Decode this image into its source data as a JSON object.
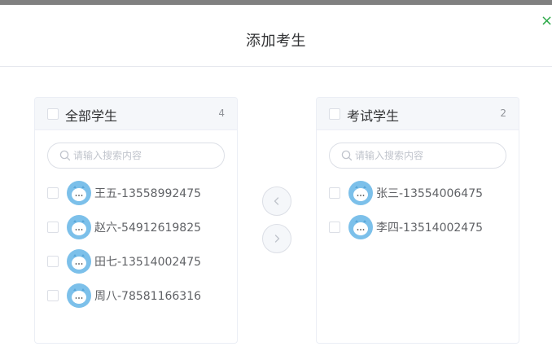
{
  "dialog": {
    "title": "添加考生",
    "close_symbol": "×"
  },
  "left_panel": {
    "title": "全部学生",
    "count": "4",
    "search_placeholder": "请输入搜索内容",
    "items": [
      {
        "label": "王五-13558992475"
      },
      {
        "label": "赵六-54912619825"
      },
      {
        "label": "田七-13514002475"
      },
      {
        "label": "周八-78581166316"
      }
    ]
  },
  "right_panel": {
    "title": "考试学生",
    "count": "2",
    "search_placeholder": "请输入搜索内容",
    "items": [
      {
        "label": "张三-13554006475"
      },
      {
        "label": "李四-13514002475"
      }
    ]
  },
  "buttons": {
    "to_left_icon": "chevron-left-icon",
    "to_right_icon": "chevron-right-icon"
  },
  "colors": {
    "close_icon": "#2eaa4a",
    "avatar_bg": "#7cc0ea",
    "panel_header_bg": "#f5f7fa",
    "border": "#dcdfe6"
  }
}
